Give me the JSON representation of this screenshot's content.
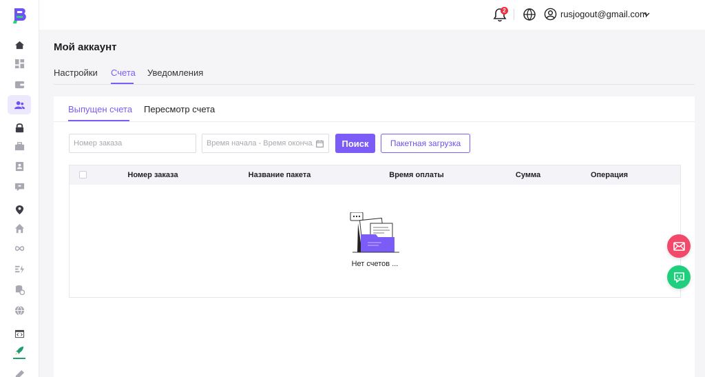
{
  "header": {
    "notification_count": "2",
    "user_email": "rusjogout@gmail.com"
  },
  "page": {
    "title": "Мой аккаунт",
    "tabs": [
      {
        "label": "Настройки",
        "active": false
      },
      {
        "label": "Счета",
        "active": true
      },
      {
        "label": "Уведомления",
        "active": false
      }
    ]
  },
  "invoices": {
    "subtabs": [
      {
        "label": "Выпущен счета",
        "active": true
      },
      {
        "label": "Пересмотр счета",
        "active": false
      }
    ],
    "filters": {
      "order_placeholder": "Номер заказа",
      "time_placeholder": "Время начала - Время оконча..."
    },
    "buttons": {
      "search": "Поиск",
      "batch_upload": "Пакетная загрузка"
    },
    "table": {
      "columns": [
        "Номер заказа",
        "Название пакета",
        "Время оплаты",
        "Сумма",
        "Операция"
      ],
      "rows": [],
      "empty_text": "Нет счетов ..."
    }
  },
  "colors": {
    "accent": "#7b5cf6",
    "badge": "#ef2d3f",
    "fab_mail": "#f2496b",
    "fab_chat": "#1fcf7e"
  },
  "sidebar": {
    "icons": [
      "home-icon",
      "dashboard-icon",
      "wallet-icon",
      "users-icon",
      "lock-icon",
      "briefcase-icon",
      "contact-card-icon",
      "message-icon",
      "location-pin-icon",
      "house-icon",
      "infinity-icon",
      "flash-list-icon",
      "database-clock-icon",
      "globe-icon",
      "code-window-icon",
      "rocket-icon",
      "tool-icon"
    ],
    "active_item": "users-icon"
  }
}
